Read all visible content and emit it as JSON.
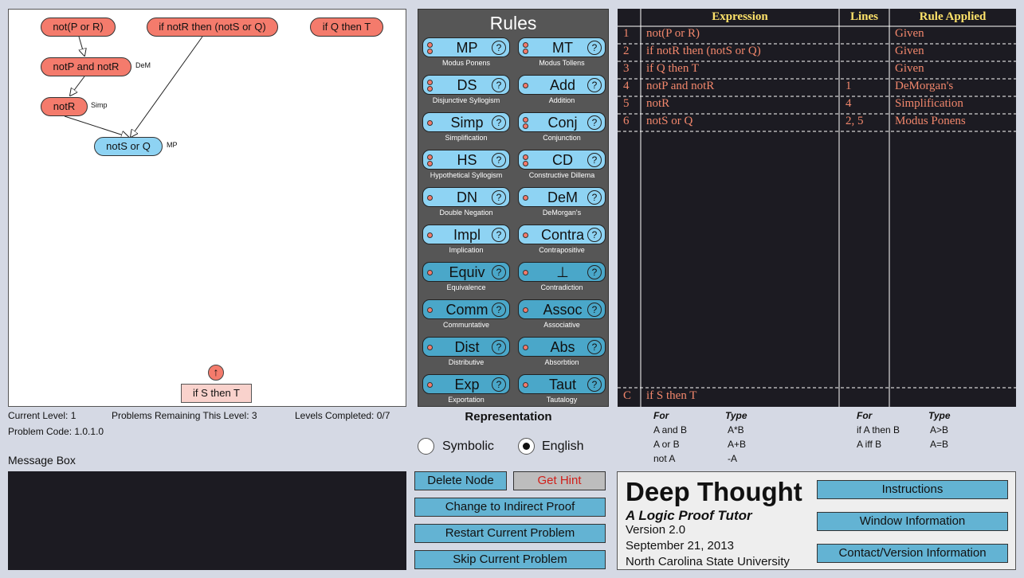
{
  "workspace": {
    "nodes": [
      {
        "id": "n1",
        "label": "not(P or R)",
        "color": "red",
        "tag": ""
      },
      {
        "id": "n2",
        "label": "if notR then (notS or Q)",
        "color": "red",
        "tag": ""
      },
      {
        "id": "n3",
        "label": "if Q then T",
        "color": "red",
        "tag": ""
      },
      {
        "id": "n4",
        "label": "notP and notR",
        "color": "red",
        "tag": "DeM"
      },
      {
        "id": "n5",
        "label": "notR",
        "color": "red",
        "tag": "Simp"
      },
      {
        "id": "n6",
        "label": "notS or Q",
        "color": "blue",
        "tag": "MP"
      }
    ],
    "goal": {
      "label": "if S then T",
      "arrow_icon": "↑"
    }
  },
  "status": {
    "current_level": "Current Level: 1",
    "problems_remaining": "Problems Remaining This Level: 3",
    "levels_completed": "Levels Completed: 0/7",
    "problem_code": "Problem Code: 1.0.1.0"
  },
  "message_box": {
    "label": "Message Box",
    "content": ""
  },
  "rules": {
    "title": "Rules",
    "items": [
      {
        "abbr": "MP",
        "name": "Modus Ponens",
        "dots": 2
      },
      {
        "abbr": "MT",
        "name": "Modus Tollens",
        "dots": 2
      },
      {
        "abbr": "DS",
        "name": "Disjunctive Syllogism",
        "dots": 2
      },
      {
        "abbr": "Add",
        "name": "Addition",
        "dots": 1
      },
      {
        "abbr": "Simp",
        "name": "Simplification",
        "dots": 1
      },
      {
        "abbr": "Conj",
        "name": "Conjunction",
        "dots": 2
      },
      {
        "abbr": "HS",
        "name": "Hypothetical Syllogism",
        "dots": 2
      },
      {
        "abbr": "CD",
        "name": "Constructive Dillema",
        "dots": 2
      },
      {
        "abbr": "DN",
        "name": "Double Negation",
        "dots": 1
      },
      {
        "abbr": "DeM",
        "name": "DeMorgan's",
        "dots": 1
      },
      {
        "abbr": "Impl",
        "name": "Implication",
        "dots": 1
      },
      {
        "abbr": "Contra",
        "name": "Contrapositive",
        "dots": 1
      },
      {
        "abbr": "Equiv",
        "name": "Equivalence",
        "dots": 1
      },
      {
        "abbr": "⊥",
        "name": "Contradiction",
        "dots": 1
      },
      {
        "abbr": "Comm",
        "name": "Communtative",
        "dots": 1
      },
      {
        "abbr": "Assoc",
        "name": "Associative",
        "dots": 1
      },
      {
        "abbr": "Dist",
        "name": "Distributive",
        "dots": 1
      },
      {
        "abbr": "Abs",
        "name": "Absorbtion",
        "dots": 1
      },
      {
        "abbr": "Exp",
        "name": "Exportation",
        "dots": 1
      },
      {
        "abbr": "Taut",
        "name": "Tautalogy",
        "dots": 1
      }
    ],
    "help_glyph": "?"
  },
  "representation": {
    "title": "Representation",
    "options": [
      {
        "label": "Symbolic",
        "selected": false
      },
      {
        "label": "English",
        "selected": true
      }
    ]
  },
  "buttons": {
    "delete_node": "Delete Node",
    "get_hint": "Get Hint",
    "change_indirect": "Change to Indirect Proof",
    "restart": "Restart Current Problem",
    "skip": "Skip Current Problem"
  },
  "proof": {
    "headers": {
      "expression": "Expression",
      "lines": "Lines",
      "rule": "Rule Applied"
    },
    "rows": [
      {
        "num": "1",
        "expression": "not(P or R)",
        "lines": "",
        "rule": "Given"
      },
      {
        "num": "2",
        "expression": "if notR then (notS or Q)",
        "lines": "",
        "rule": "Given"
      },
      {
        "num": "3",
        "expression": "if Q then T",
        "lines": "",
        "rule": "Given"
      },
      {
        "num": "4",
        "expression": "notP and notR",
        "lines": "1",
        "rule": "DeMorgan's"
      },
      {
        "num": "5",
        "expression": "notR",
        "lines": "4",
        "rule": "Simplification"
      },
      {
        "num": "6",
        "expression": "notS or Q",
        "lines": "2, 5",
        "rule": "Modus Ponens"
      }
    ],
    "conclusion": {
      "num": "C",
      "expression": "if S then T"
    }
  },
  "legend": {
    "head_for": "For",
    "head_type": "Type",
    "left": [
      {
        "for": "A and B",
        "type": "A*B"
      },
      {
        "for": "A or B",
        "type": "A+B"
      },
      {
        "for": "not A",
        "type": "-A"
      }
    ],
    "right": [
      {
        "for": "if A then B",
        "type": "A>B"
      },
      {
        "for": "A iff B",
        "type": "A=B"
      }
    ]
  },
  "info": {
    "title": "Deep Thought",
    "subtitle": "A Logic Proof Tutor",
    "version": "Version 2.0",
    "date": "September 21, 2013",
    "org": "North Carolina State University",
    "buttons": {
      "instructions": "Instructions",
      "window_info": "Window Information",
      "contact": "Contact/Version Information"
    }
  },
  "colors": {
    "node_red": "#f47b6c",
    "node_blue": "#8ed3f3",
    "header_yellow": "#ffe36a",
    "proof_text": "#f2876c",
    "panel_dark": "#1c1b22"
  }
}
